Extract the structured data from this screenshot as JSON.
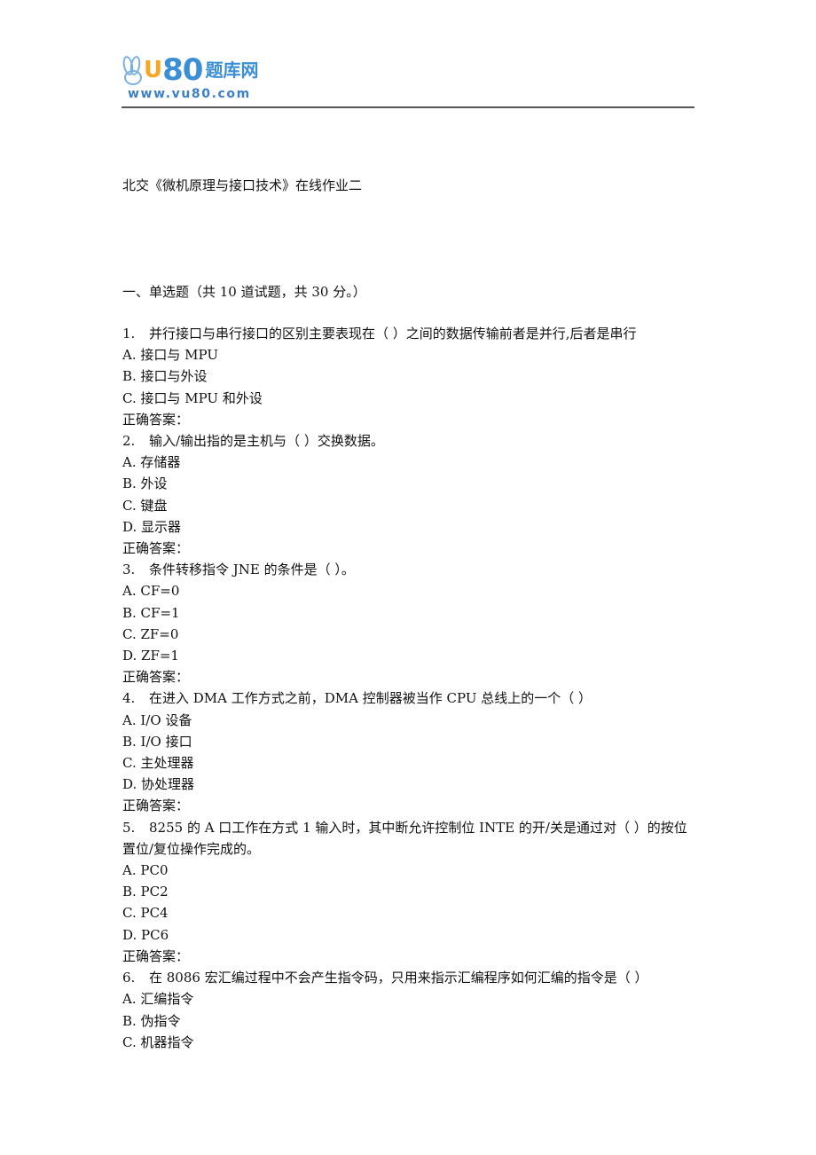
{
  "header": {
    "logo_brand": "vu80",
    "logo_u": "U",
    "logo_80": "80",
    "logo_cn": "题库网",
    "logo_url": "www.vu80.com",
    "brand_colors": {
      "blue": "#3b8fd6",
      "orange": "#f5a623"
    }
  },
  "document": {
    "title": "北交《微机原理与接口技术》在线作业二",
    "section_heading": "一、单选题（共 10 道试题，共 30 分。）",
    "answer_label": "正确答案：",
    "questions": [
      {
        "number": "1.",
        "stem": "并行接口与串行接口的区别主要表现在（ ）之间的数据传输前者是并行,后者是串行",
        "options": [
          "A. 接口与 MPU",
          "B. 接口与外设",
          "C. 接口与 MPU 和外设"
        ],
        "answer_label": "正确答案："
      },
      {
        "number": "2.",
        "stem": "输入/输出指的是主机与（ ）交换数据。",
        "options": [
          "A. 存储器",
          "B. 外设",
          "C. 键盘",
          "D. 显示器"
        ],
        "answer_label": "正确答案："
      },
      {
        "number": "3.",
        "stem": "条件转移指令 JNE 的条件是（ ）。",
        "options": [
          "A. CF=0",
          "B. CF=1",
          "C. ZF=0",
          "D. ZF=1"
        ],
        "answer_label": "正确答案："
      },
      {
        "number": "4.",
        "stem": "在进入 DMA 工作方式之前，DMA 控制器被当作 CPU 总线上的一个（ ）",
        "options": [
          "A. I/O 设备",
          "B. I/O 接口",
          "C. 主处理器",
          "D. 协处理器"
        ],
        "answer_label": "正确答案："
      },
      {
        "number": "5.",
        "stem": "8255 的 A 口工作在方式 1 输入时，其中断允许控制位 INTE 的开/关是通过对（ ）的按位置位/复位操作完成的。",
        "options": [
          "A. PC0",
          "B. PC2",
          "C. PC4",
          "D. PC6"
        ],
        "answer_label": "正确答案："
      },
      {
        "number": "6.",
        "stem": "在 8086 宏汇编过程中不会产生指令码，只用来指示汇编程序如何汇编的指令是（ ）",
        "options": [
          "A. 汇编指令",
          "B. 伪指令",
          "C. 机器指令"
        ]
      }
    ]
  }
}
